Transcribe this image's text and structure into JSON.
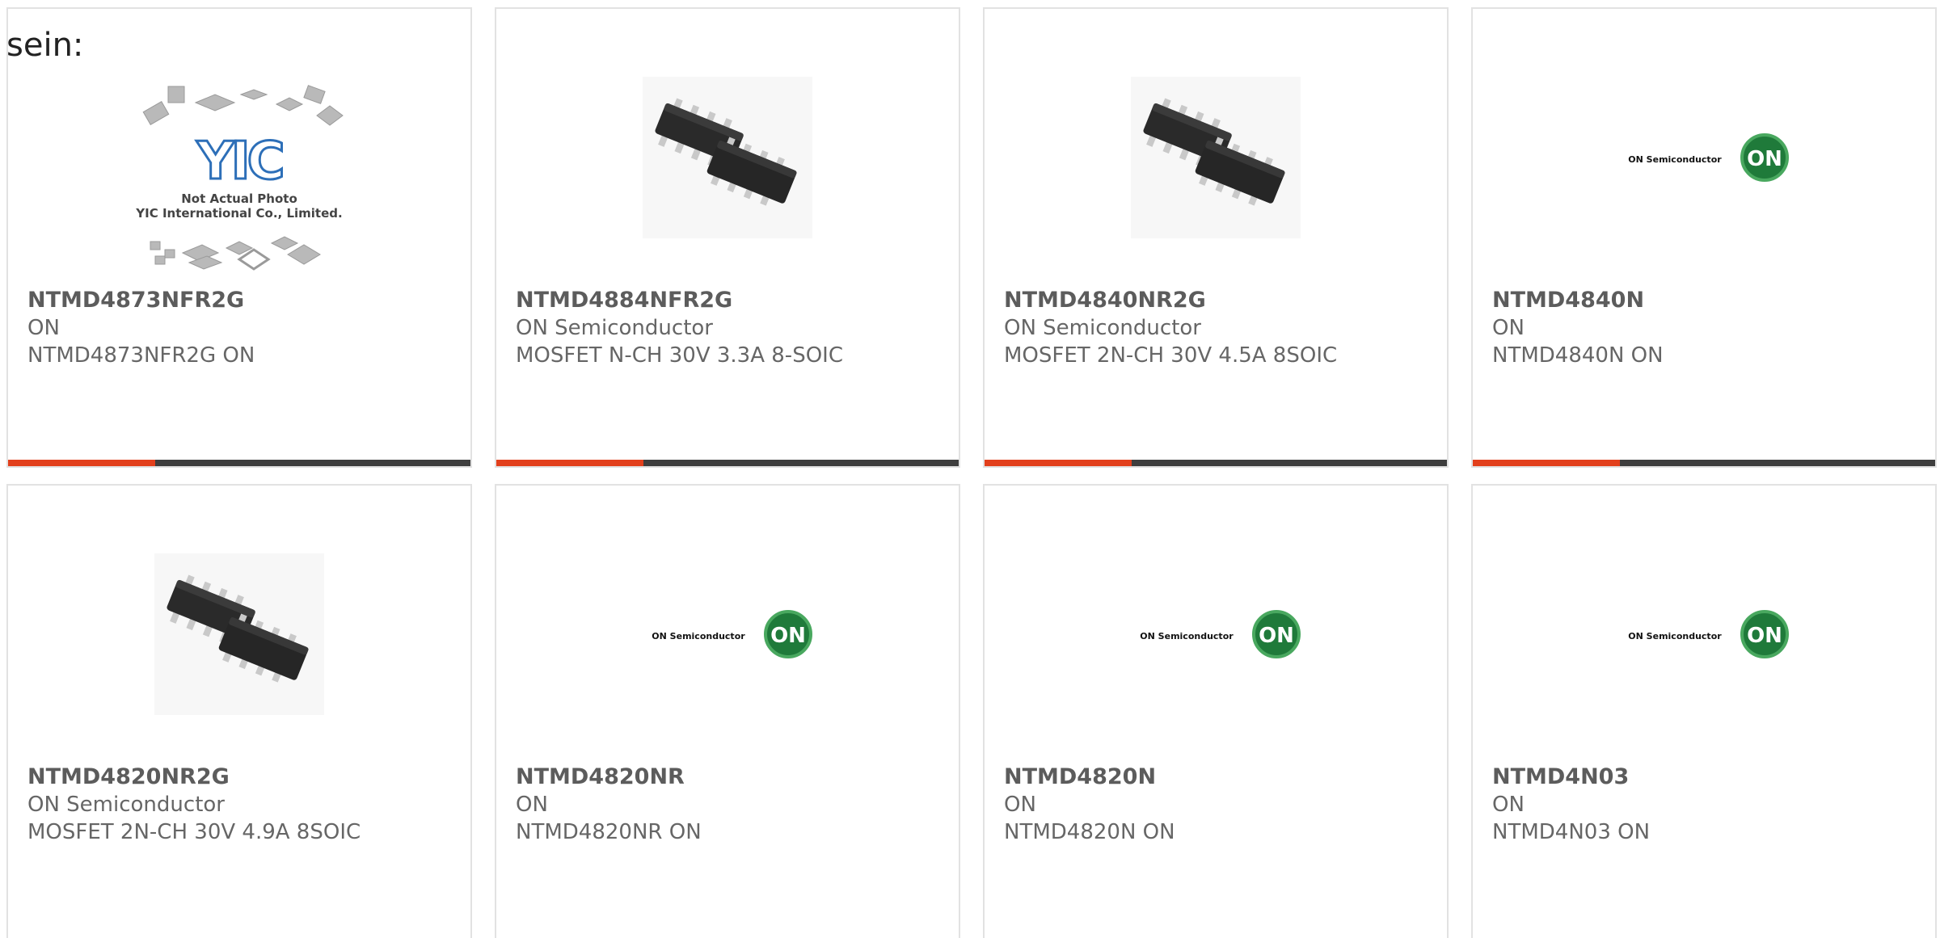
{
  "heading": "sein:",
  "colors": {
    "card_border": "#e2e2e2",
    "bar_dark": "#3e3e3e",
    "bar_accent": "#e2401c",
    "text": "#666666"
  },
  "products": [
    {
      "part_number": "NTMD4873NFR2G",
      "manufacturer": "ON",
      "description": "NTMD4873NFR2G ON",
      "image": "placeholder",
      "image_text": [
        "YIC",
        "Not Actual Photo",
        "YIC International Co., Limited."
      ]
    },
    {
      "part_number": "NTMD4884NFR2G",
      "manufacturer": "ON Semiconductor",
      "description": "MOSFET N-CH 30V 3.3A 8-SOIC",
      "image": "soic-chips"
    },
    {
      "part_number": "NTMD4840NR2G",
      "manufacturer": "ON Semiconductor",
      "description": "MOSFET 2N-CH 30V 4.5A 8SOIC",
      "image": "soic-chips"
    },
    {
      "part_number": "NTMD4840N",
      "manufacturer": "ON",
      "description": "NTMD4840N ON",
      "image": "on-logo",
      "image_text": [
        "ON Semiconductor",
        "ON"
      ]
    },
    {
      "part_number": "NTMD4820NR2G",
      "manufacturer": "ON Semiconductor",
      "description": "MOSFET 2N-CH 30V 4.9A 8SOIC",
      "image": "soic-chips"
    },
    {
      "part_number": "NTMD4820NR",
      "manufacturer": "ON",
      "description": "NTMD4820NR ON",
      "image": "on-logo",
      "image_text": [
        "ON Semiconductor",
        "ON"
      ]
    },
    {
      "part_number": "NTMD4820N",
      "manufacturer": "ON",
      "description": "NTMD4820N ON",
      "image": "on-logo",
      "image_text": [
        "ON Semiconductor",
        "ON"
      ]
    },
    {
      "part_number": "NTMD4N03",
      "manufacturer": "ON",
      "description": "NTMD4N03 ON",
      "image": "on-logo",
      "image_text": [
        "ON Semiconductor",
        "ON"
      ]
    }
  ]
}
